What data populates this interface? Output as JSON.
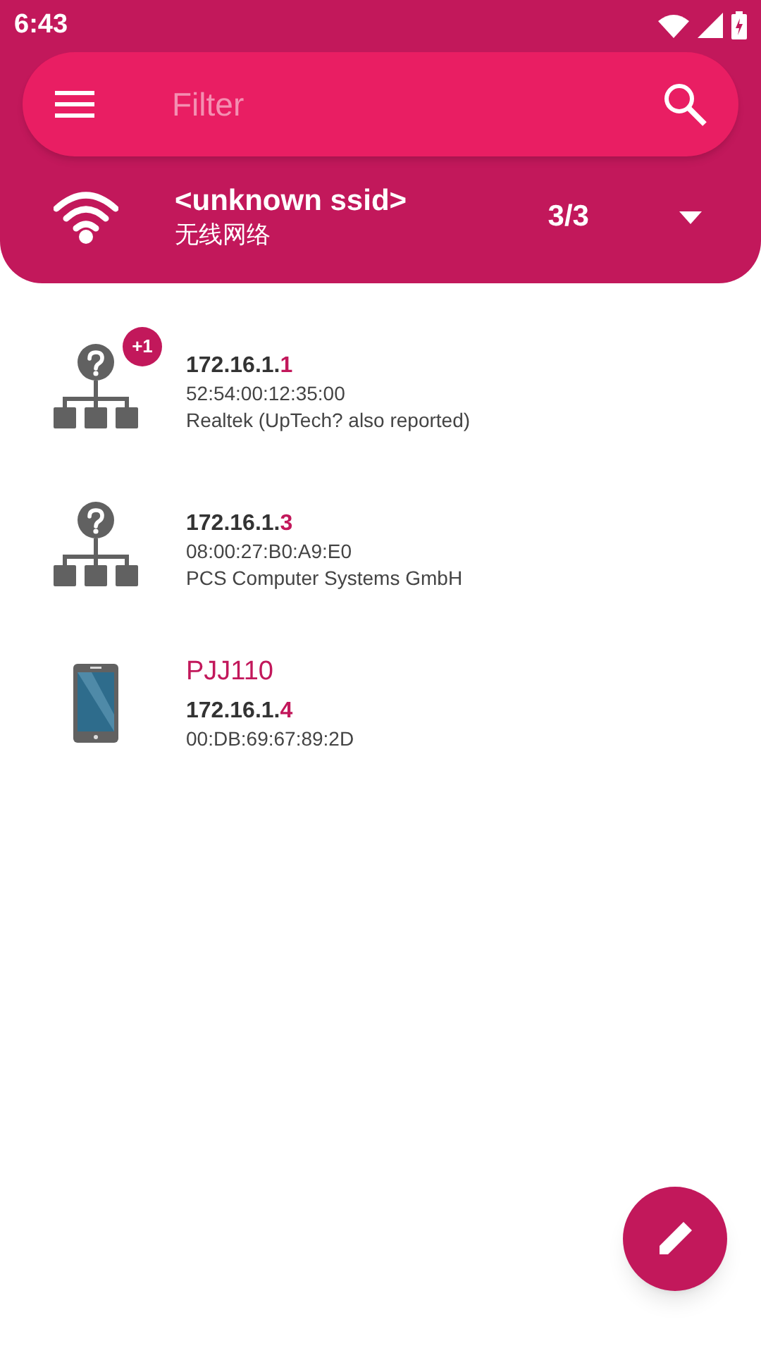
{
  "status_bar": {
    "time": "6:43"
  },
  "search": {
    "placeholder": "Filter"
  },
  "network": {
    "ssid": "<unknown ssid>",
    "type": "无线网络",
    "count": "3/3"
  },
  "devices": [
    {
      "kind": "unknown",
      "badge": "+1",
      "ip_network": "172.16.1.",
      "ip_host": "1",
      "mac": "52:54:00:12:35:00",
      "vendor": "Realtek (UpTech? also reported)"
    },
    {
      "kind": "unknown",
      "ip_network": "172.16.1.",
      "ip_host": "3",
      "mac": "08:00:27:B0:A9:E0",
      "vendor": "PCS Computer Systems GmbH"
    },
    {
      "kind": "phone",
      "name": "PJJ110",
      "ip_network": "172.16.1.",
      "ip_host": "4",
      "mac": "00:DB:69:67:89:2D"
    }
  ]
}
